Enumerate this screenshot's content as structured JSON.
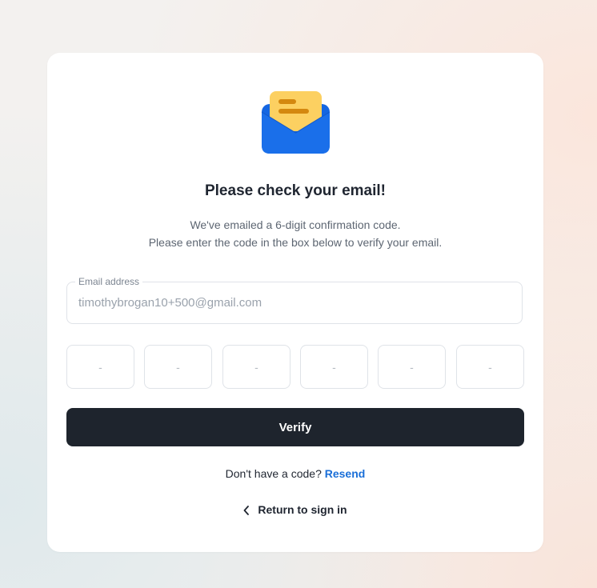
{
  "page": {
    "title": "Please check your email!",
    "subtitle_line1": "We've emailed a 6-digit confirmation code.",
    "subtitle_line2": "Please enter the code in the box below to verify your email."
  },
  "email_field": {
    "label": "Email address",
    "value": "timothybrogan10+500@gmail.com"
  },
  "code_inputs": {
    "placeholders": [
      "-",
      "-",
      "-",
      "-",
      "-",
      "-"
    ]
  },
  "verify_button": {
    "label": "Verify"
  },
  "resend": {
    "prompt": "Don't have a code?",
    "link_label": "Resend"
  },
  "return_link": {
    "label": "Return to sign in"
  },
  "icons": {
    "header": "envelope-letter-icon",
    "back": "chevron-left-icon"
  },
  "colors": {
    "button_bg": "#1e242d",
    "link": "#1a6fd8",
    "envelope_blue": "#1668e3",
    "letter_yellow": "#fcd061"
  }
}
